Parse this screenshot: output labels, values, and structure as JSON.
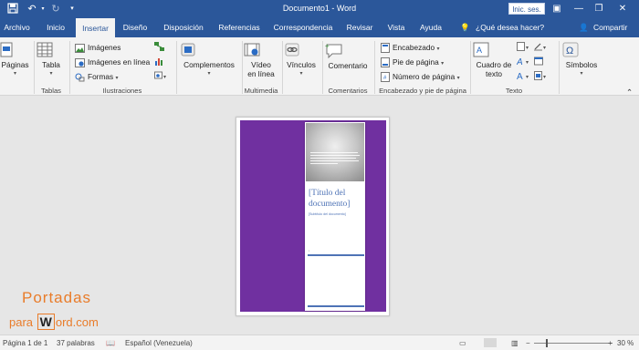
{
  "titlebar": {
    "doc_title": "Documento1 - Word",
    "signin_label": "Inic. ses."
  },
  "tabs": [
    {
      "label": "Archivo"
    },
    {
      "label": "Inicio"
    },
    {
      "label": "Insertar"
    },
    {
      "label": "Diseño"
    },
    {
      "label": "Disposición"
    },
    {
      "label": "Referencias"
    },
    {
      "label": "Correspondencia"
    },
    {
      "label": "Revisar"
    },
    {
      "label": "Vista"
    },
    {
      "label": "Ayuda"
    }
  ],
  "tell_me": "¿Qué desea hacer?",
  "share": "Compartir",
  "ribbon": {
    "paginas": "Páginas",
    "tabla": "Tabla",
    "imagenes": "Imágenes",
    "imagenes_linea": "Imágenes en línea",
    "formas": "Formas",
    "complementos": "Complementos",
    "video_1": "Vídeo",
    "video_2": "en línea",
    "vinculos": "Vínculos",
    "comentario": "Comentario",
    "encabezado": "Encabezado",
    "pie_pagina": "Pie de página",
    "numero_pagina": "Número de página",
    "cuadro_1": "Cuadro de",
    "cuadro_2": "texto",
    "simbolos": "Símbolos",
    "groups": {
      "tablas": "Tablas",
      "ilustraciones": "Ilustraciones",
      "multimedia": "Multimedia",
      "comentarios": "Comentarios",
      "encabezado_pie": "Encabezado y pie de página",
      "texto": "Texto"
    }
  },
  "cover": {
    "title_1": "[Título del",
    "title_2": "documento]",
    "subtitle": "[Subtítulo del documento]"
  },
  "logo": {
    "line1": "Portadas",
    "pre": "para",
    "w": "W",
    "post": "ord.com"
  },
  "status": {
    "page": "Página 1 de 1",
    "words": "37 palabras",
    "language": "Español (Venezuela)",
    "zoom": "30 %"
  },
  "colors": {
    "accent": "#2b579a",
    "cover_purple": "#7030a0",
    "cover_blue": "#4e73b6",
    "logo_orange": "#e97c2a"
  }
}
